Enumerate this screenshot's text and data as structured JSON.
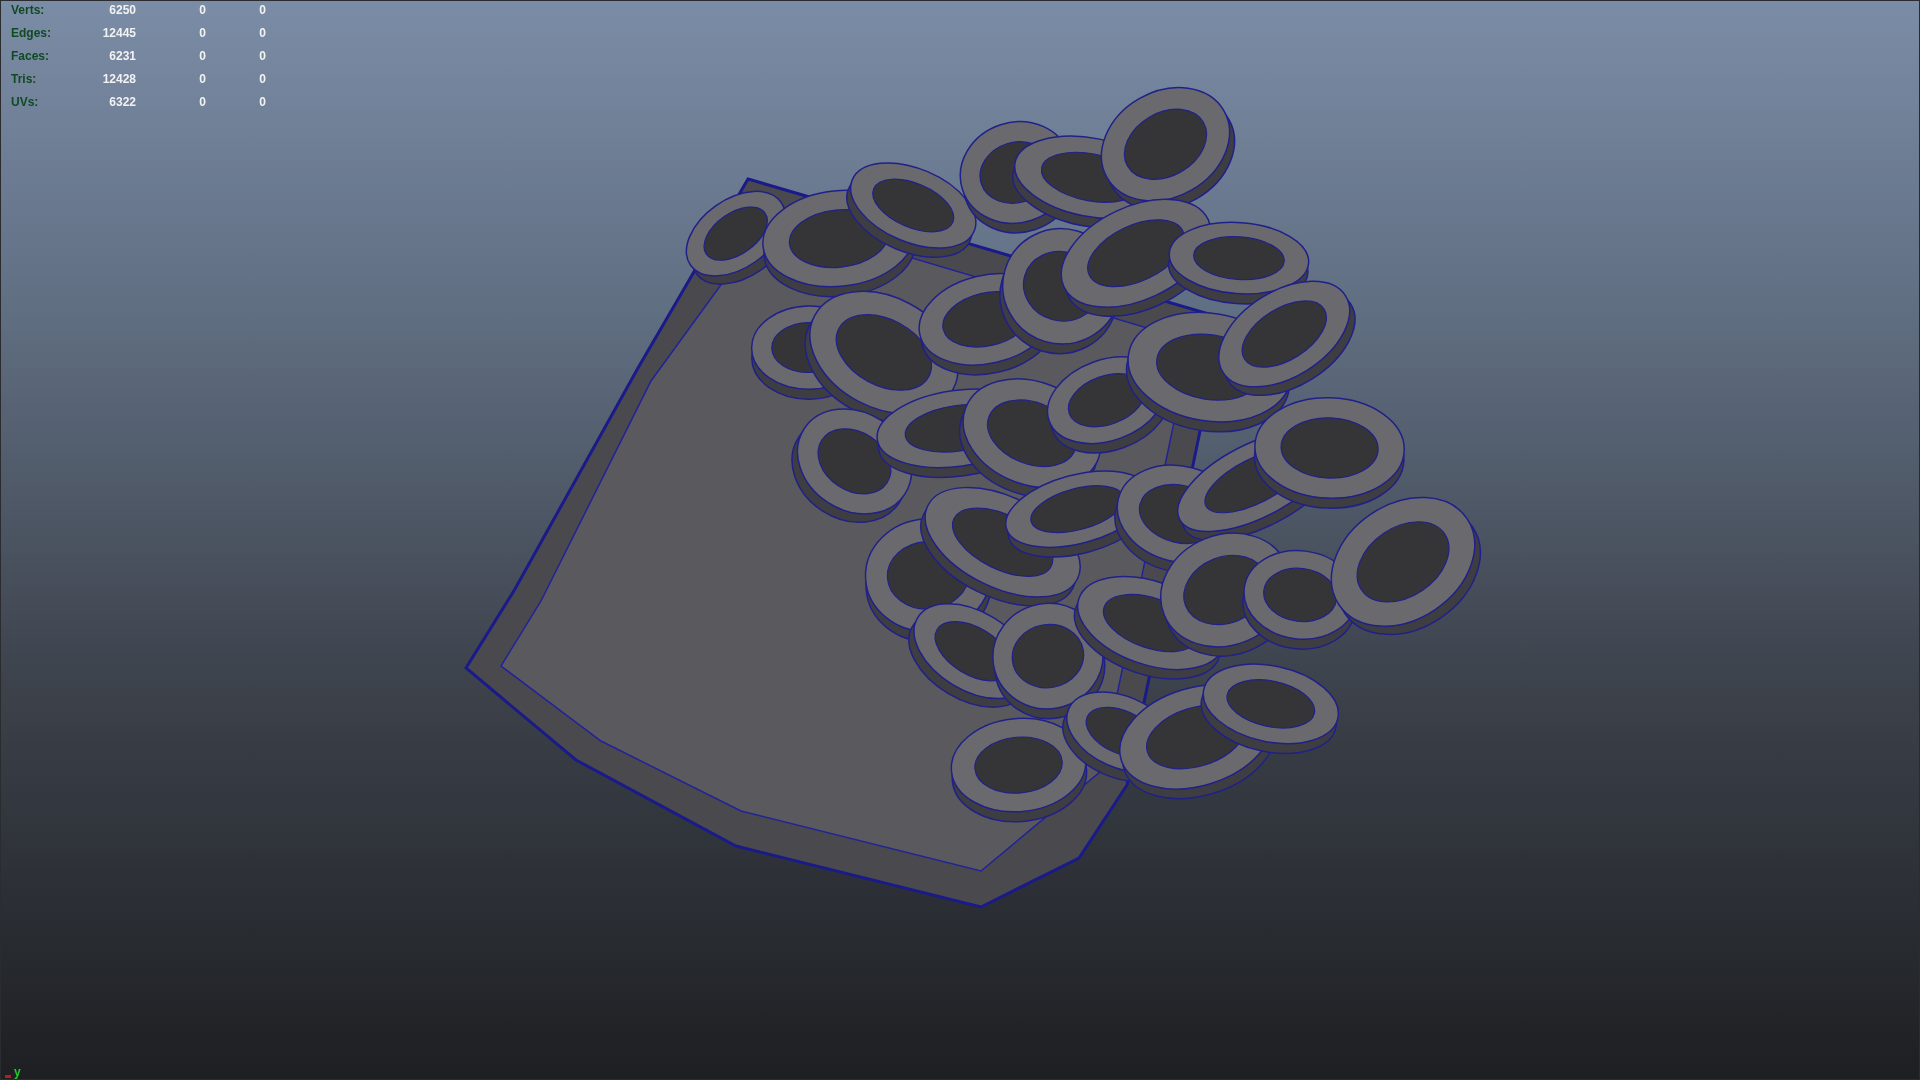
{
  "hud": {
    "rows": [
      {
        "label": "Verts:",
        "values": [
          "6250",
          "0",
          "0"
        ]
      },
      {
        "label": "Edges:",
        "values": [
          "12445",
          "0",
          "0"
        ]
      },
      {
        "label": "Faces:",
        "values": [
          "6231",
          "0",
          "0"
        ]
      },
      {
        "label": "Tris:",
        "values": [
          "12428",
          "0",
          "0"
        ]
      },
      {
        "label": "UVs:",
        "values": [
          "6322",
          "0",
          "0"
        ]
      }
    ]
  },
  "axis_label": "y"
}
